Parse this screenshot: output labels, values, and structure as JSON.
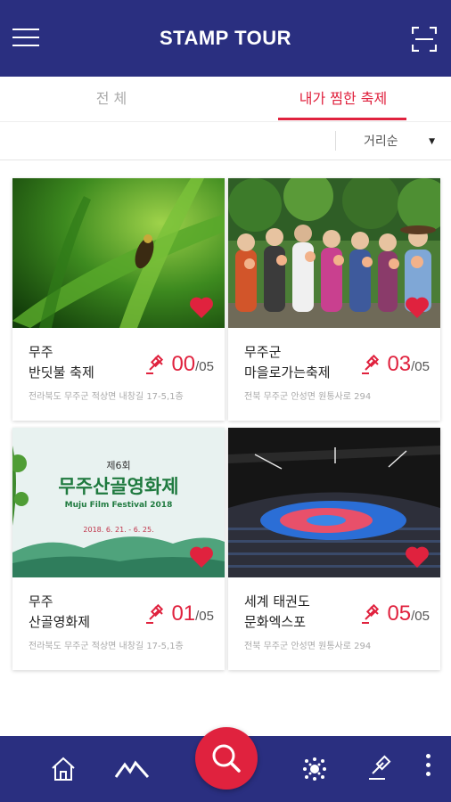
{
  "app": {
    "title": "STAMP TOUR"
  },
  "tabs": [
    {
      "label": "전  체",
      "active": false
    },
    {
      "label": "내가 찜한 축제",
      "active": true
    }
  ],
  "sort": {
    "selected": "거리순"
  },
  "festivals": [
    {
      "name": "무주\n반딧불 축제",
      "stamps": "00",
      "total": "/05",
      "address": "전라북도 무주군 적상면 내창길 17-5,1층",
      "favorite": true,
      "image": "firefly-on-grass"
    },
    {
      "name": "무주군\n마을로가는축제",
      "stamps": "03",
      "total": "/05",
      "address": "전북 무주군 안성면 원통사로 294",
      "favorite": true,
      "image": "group-holding-peaches"
    },
    {
      "name": "무주\n산골영화제",
      "stamps": "01",
      "total": "/05",
      "address": "전라북도 무주군 적상면 내창길 17-5,1층",
      "favorite": true,
      "image": "film-festival-poster",
      "poster": {
        "edition": "제6회",
        "title": "무주산골영화제",
        "subtitle": "Muju Film Festival 2018",
        "dates": "2018. 6. 21. - 6. 25."
      }
    },
    {
      "name": "세계 태권도\n문화엑스포",
      "stamps": "05",
      "total": "/05",
      "address": "전북 무주군 안성면 원통사로 294",
      "favorite": true,
      "image": "taekwondo-arena"
    }
  ],
  "colors": {
    "primary": "#2a2f80",
    "accent": "#e0223e"
  },
  "bottom_nav": [
    "home-icon",
    "mountain-icon",
    "search-icon",
    "festival-icon",
    "my-stamp-icon",
    "more-icon"
  ]
}
